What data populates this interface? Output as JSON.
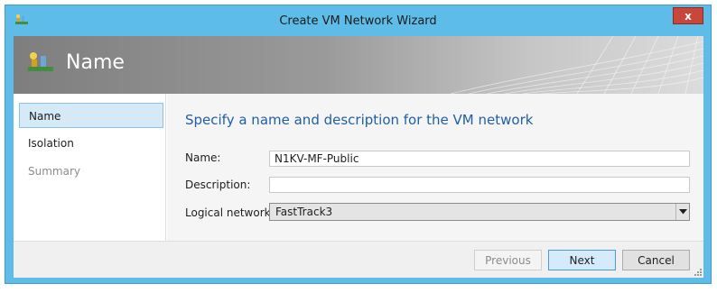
{
  "window": {
    "title": "Create VM Network Wizard",
    "close_label": "x",
    "app_icon": "network-wizard-icon"
  },
  "banner": {
    "title": "Name",
    "icon": "network-wizard-icon"
  },
  "sidebar": {
    "items": [
      {
        "label": "Name",
        "state": "active"
      },
      {
        "label": "Isolation",
        "state": "normal"
      },
      {
        "label": "Summary",
        "state": "disabled"
      }
    ]
  },
  "main": {
    "heading": "Specify a name and description for the VM network",
    "fields": {
      "name": {
        "label": "Name:",
        "value": "N1KV-MF-Public"
      },
      "description": {
        "label": "Description:",
        "value": ""
      },
      "logical_network": {
        "label": "Logical network:",
        "selected": "FastTrack3"
      }
    }
  },
  "footer": {
    "previous_label": "Previous",
    "next_label": "Next",
    "cancel_label": "Cancel"
  },
  "colors": {
    "frame": "#5ebde8",
    "heading": "#1f5fa6",
    "active_item": "#d5e9f7",
    "close": "#c7473b"
  }
}
